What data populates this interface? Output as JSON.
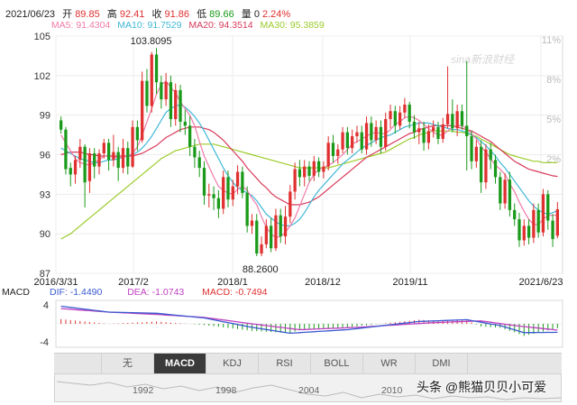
{
  "header": {
    "date": "2021/06/23",
    "open_label": "开",
    "open": "89.85",
    "high_label": "高",
    "high": "92.41",
    "close_label": "收",
    "close": "91.86",
    "low_label": "低",
    "low": "89.66",
    "vol_label": "量",
    "vol": "0",
    "change": "2.24%"
  },
  "ma": {
    "ma5": "MA5: 91.4304",
    "ma10": "MA10: 91.7529",
    "ma20": "MA20: 94.3514",
    "ma30": "MA30: 95.3859"
  },
  "colors": {
    "up": "#e03030",
    "down": "#1a9a1a",
    "ma5": "#f07aa8",
    "ma10": "#3fb8d8",
    "ma20": "#d83a5a",
    "ma30": "#9ccc2a",
    "dif": "#3a5ad0",
    "dea": "#c040c0"
  },
  "watermark_logo": "sina新浪财经",
  "chart_data": {
    "type": "candlestick",
    "ylim": [
      87,
      105
    ],
    "y_ticks": [
      "105",
      "102",
      "99",
      "96",
      "93",
      "90",
      "87"
    ],
    "right_ticks": [
      "11%",
      "8%",
      "5%",
      "2%"
    ],
    "x_ticks": [
      "2016/3/31",
      "2017/2",
      "2018/1",
      "2018/12",
      "2019/11",
      "2021/6/23"
    ],
    "annotations": [
      "103.8095",
      "88.2600"
    ],
    "candles": [
      [
        98.6,
        97.9,
        98.9,
        97.6
      ],
      [
        97.9,
        94.9,
        98.1,
        94.5
      ],
      [
        95.0,
        94.5,
        95.4,
        93.6
      ],
      [
        94.5,
        95.6,
        95.9,
        93.8
      ],
      [
        95.6,
        96.6,
        97.2,
        95.0
      ],
      [
        96.6,
        93.9,
        96.8,
        92.0
      ],
      [
        94.0,
        96.1,
        96.5,
        93.1
      ],
      [
        96.1,
        95.1,
        96.5,
        94.2
      ],
      [
        95.1,
        96.1,
        96.4,
        94.5
      ],
      [
        96.1,
        96.9,
        97.2,
        95.7
      ],
      [
        96.9,
        95.6,
        97.2,
        94.8
      ],
      [
        95.6,
        96.2,
        97.5,
        95.1
      ],
      [
        96.2,
        95.0,
        96.6,
        94.0
      ],
      [
        95.0,
        96.5,
        97.2,
        94.6
      ],
      [
        96.5,
        95.1,
        97.0,
        94.5
      ],
      [
        95.1,
        98.1,
        98.6,
        95.0
      ],
      [
        98.1,
        97.1,
        98.6,
        96.3
      ],
      [
        97.1,
        101.6,
        102.3,
        96.9
      ],
      [
        101.6,
        99.7,
        102.5,
        99.2
      ],
      [
        99.7,
        103.6,
        103.8,
        99.2
      ],
      [
        103.6,
        101.5,
        104.1,
        100.6
      ],
      [
        101.5,
        100.2,
        102.0,
        99.5
      ],
      [
        100.2,
        101.5,
        102.2,
        99.7
      ],
      [
        101.5,
        98.7,
        102.0,
        98.1
      ],
      [
        98.7,
        100.9,
        101.4,
        98.2
      ],
      [
        100.9,
        98.5,
        101.3,
        97.7
      ],
      [
        98.5,
        98.2,
        99.4,
        97.5
      ],
      [
        98.2,
        96.6,
        98.9,
        95.9
      ],
      [
        96.6,
        95.8,
        97.2,
        95.0
      ],
      [
        95.8,
        95.0,
        96.3,
        94.3
      ],
      [
        95.0,
        92.9,
        95.5,
        92.2
      ],
      [
        92.9,
        93.0,
        93.8,
        92.0
      ],
      [
        93.0,
        92.7,
        93.6,
        91.8
      ],
      [
        92.7,
        91.9,
        93.3,
        91.2
      ],
      [
        91.9,
        94.3,
        94.8,
        91.5
      ],
      [
        94.3,
        92.6,
        94.8,
        92.0
      ],
      [
        92.6,
        93.6,
        94.1,
        92.1
      ],
      [
        93.6,
        94.7,
        95.2,
        93.0
      ],
      [
        94.7,
        93.1,
        95.1,
        92.7
      ],
      [
        93.1,
        90.6,
        93.6,
        90.1
      ],
      [
        90.6,
        91.0,
        91.5,
        90.0
      ],
      [
        91.0,
        88.5,
        91.5,
        88.3
      ],
      [
        88.5,
        89.2,
        89.8,
        88.3
      ],
      [
        89.2,
        90.6,
        91.1,
        88.9
      ],
      [
        90.6,
        88.9,
        91.2,
        88.6
      ],
      [
        88.9,
        91.4,
        91.9,
        88.7
      ],
      [
        91.4,
        89.8,
        91.9,
        89.3
      ],
      [
        89.8,
        91.3,
        92.1,
        89.2
      ],
      [
        91.3,
        93.2,
        93.7,
        90.8
      ],
      [
        93.2,
        94.9,
        95.4,
        92.6
      ],
      [
        94.9,
        94.3,
        95.6,
        93.6
      ],
      [
        94.3,
        95.1,
        95.6,
        93.6
      ],
      [
        95.1,
        94.4,
        95.5,
        94.0
      ],
      [
        94.4,
        95.5,
        95.9,
        94.0
      ],
      [
        95.5,
        94.7,
        95.8,
        94.3
      ],
      [
        94.7,
        95.1,
        95.5,
        94.2
      ],
      [
        95.1,
        96.9,
        97.4,
        94.8
      ],
      [
        96.9,
        95.9,
        97.5,
        95.4
      ],
      [
        95.9,
        96.4,
        96.8,
        95.3
      ],
      [
        96.4,
        97.7,
        98.1,
        96.1
      ],
      [
        97.7,
        96.5,
        98.1,
        96.0
      ],
      [
        96.5,
        97.4,
        97.9,
        96.1
      ],
      [
        97.4,
        97.7,
        98.2,
        96.9
      ],
      [
        97.7,
        96.4,
        98.2,
        96.1
      ],
      [
        96.4,
        98.4,
        98.9,
        96.0
      ],
      [
        98.4,
        97.1,
        98.9,
        96.6
      ],
      [
        97.1,
        98.1,
        98.6,
        96.8
      ],
      [
        98.1,
        96.6,
        98.6,
        96.1
      ],
      [
        96.6,
        98.7,
        99.2,
        96.3
      ],
      [
        98.7,
        99.3,
        99.8,
        98.0
      ],
      [
        99.3,
        98.2,
        99.7,
        97.6
      ],
      [
        98.2,
        99.2,
        99.7,
        97.9
      ],
      [
        99.2,
        99.8,
        100.3,
        98.8
      ],
      [
        99.8,
        98.5,
        100.0,
        98.0
      ],
      [
        98.5,
        97.7,
        99.0,
        97.2
      ],
      [
        97.7,
        98.0,
        98.5,
        96.8
      ],
      [
        98.0,
        96.9,
        98.5,
        96.3
      ],
      [
        96.9,
        97.8,
        98.3,
        96.4
      ],
      [
        97.8,
        98.1,
        98.6,
        97.3
      ],
      [
        98.1,
        97.2,
        98.5,
        96.8
      ],
      [
        97.2,
        98.3,
        98.8,
        96.9
      ],
      [
        98.3,
        99.1,
        102.7,
        98.0
      ],
      [
        99.1,
        98.0,
        100.2,
        97.7
      ],
      [
        98.0,
        99.3,
        99.8,
        97.4
      ],
      [
        99.3,
        98.2,
        99.8,
        97.9
      ],
      [
        98.2,
        97.4,
        103.1,
        94.8
      ],
      [
        97.4,
        95.5,
        97.8,
        94.9
      ],
      [
        95.5,
        96.6,
        97.1,
        95.0
      ],
      [
        96.6,
        93.9,
        97.1,
        93.1
      ],
      [
        93.9,
        96.4,
        96.8,
        93.4
      ],
      [
        96.4,
        95.6,
        96.9,
        94.9
      ],
      [
        95.6,
        94.3,
        96.0,
        93.8
      ],
      [
        94.3,
        92.3,
        94.7,
        91.8
      ],
      [
        92.3,
        94.1,
        94.6,
        91.9
      ],
      [
        94.1,
        91.8,
        94.7,
        91.3
      ],
      [
        91.8,
        91.1,
        92.3,
        90.6
      ],
      [
        91.1,
        89.5,
        91.6,
        89.0
      ],
      [
        89.5,
        90.6,
        91.1,
        89.1
      ],
      [
        90.6,
        89.7,
        91.1,
        89.2
      ],
      [
        89.7,
        91.8,
        92.3,
        89.3
      ],
      [
        91.8,
        90.1,
        92.3,
        89.7
      ],
      [
        90.1,
        93.0,
        93.4,
        89.8
      ],
      [
        93.0,
        91.0,
        93.3,
        90.3
      ],
      [
        91.0,
        89.6,
        91.5,
        89.0
      ],
      [
        89.85,
        91.86,
        92.41,
        89.66
      ]
    ],
    "ma5": [
      97.5,
      96.9,
      96.3,
      95.7,
      95.4,
      95.3,
      95.2,
      95.4,
      95.6,
      95.9,
      95.9,
      95.8,
      95.8,
      95.8,
      95.9,
      96.1,
      96.6,
      97.5,
      98.5,
      99.5,
      100.6,
      101.3,
      101.6,
      101.1,
      100.7,
      100.0,
      99.5,
      99.0,
      98.2,
      97.0,
      95.9,
      95.1,
      94.3,
      93.6,
      93.3,
      93.1,
      93.0,
      93.4,
      93.6,
      93.3,
      92.7,
      92.2,
      91.3,
      90.5,
      90.0,
      89.7,
      89.8,
      90.1,
      90.6,
      91.2,
      92.1,
      93.0,
      93.9,
      94.5,
      94.9,
      95.0,
      95.2,
      95.4,
      95.7,
      96.0,
      96.4,
      96.8,
      97.0,
      97.2,
      97.4,
      97.6,
      97.7,
      97.6,
      97.6,
      97.9,
      98.3,
      98.5,
      98.8,
      98.9,
      98.8,
      98.6,
      98.3,
      98.0,
      97.7,
      97.5,
      97.5,
      97.8,
      98.1,
      98.2,
      98.2,
      98.0,
      97.6,
      97.2,
      96.6,
      96.2,
      95.7,
      95.2,
      94.9,
      94.5,
      93.8,
      93.2,
      92.4,
      91.7,
      91.1,
      90.7,
      90.7,
      91.1,
      91.4,
      91.4,
      91.4
    ],
    "ma10": [
      96.5,
      96.3,
      96.1,
      95.9,
      95.7,
      95.6,
      95.5,
      95.4,
      95.4,
      95.5,
      95.6,
      95.6,
      95.7,
      95.8,
      95.9,
      96.0,
      96.2,
      96.5,
      96.9,
      97.4,
      98.0,
      98.6,
      99.2,
      99.5,
      99.7,
      99.8,
      99.6,
      99.3,
      98.9,
      98.4,
      97.8,
      97.1,
      96.4,
      95.7,
      95.0,
      94.4,
      93.9,
      93.5,
      93.3,
      93.1,
      92.9,
      92.5,
      92.0,
      91.5,
      91.2,
      90.9,
      90.7,
      90.6,
      90.6,
      90.8,
      91.1,
      91.6,
      92.2,
      92.8,
      93.3,
      93.7,
      94.1,
      94.5,
      94.9,
      95.3,
      95.6,
      95.9,
      96.2,
      96.5,
      96.7,
      96.9,
      97.1,
      97.3,
      97.4,
      97.5,
      97.7,
      97.9,
      98.1,
      98.2,
      98.3,
      98.4,
      98.4,
      98.4,
      98.3,
      98.2,
      98.1,
      98.0,
      97.9,
      97.9,
      97.8,
      97.7,
      97.5,
      97.3,
      97.0,
      96.7,
      96.3,
      95.9,
      95.4,
      95.0,
      94.5,
      94.0,
      93.5,
      93.0,
      92.5,
      92.1,
      91.8,
      91.6,
      91.5,
      91.6,
      91.75
    ],
    "ma20": [
      96.0,
      96.1,
      96.2,
      96.2,
      96.2,
      96.1,
      96.0,
      96.0,
      95.9,
      95.9,
      95.9,
      95.9,
      95.9,
      95.9,
      95.9,
      95.9,
      96.0,
      96.1,
      96.3,
      96.5,
      96.7,
      97.0,
      97.3,
      97.5,
      97.7,
      97.9,
      98.0,
      98.1,
      98.1,
      98.1,
      98.0,
      97.9,
      97.7,
      97.4,
      97.1,
      96.7,
      96.3,
      95.9,
      95.5,
      95.0,
      94.6,
      94.2,
      93.8,
      93.5,
      93.1,
      92.8,
      92.6,
      92.4,
      92.2,
      92.2,
      92.2,
      92.3,
      92.4,
      92.6,
      92.8,
      93.1,
      93.4,
      93.7,
      94.0,
      94.3,
      94.6,
      94.9,
      95.2,
      95.5,
      95.8,
      96.0,
      96.2,
      96.4,
      96.6,
      96.8,
      97.0,
      97.2,
      97.4,
      97.6,
      97.7,
      97.9,
      98.0,
      98.1,
      98.2,
      98.2,
      98.2,
      98.2,
      98.2,
      98.1,
      98.0,
      97.9,
      97.8,
      97.6,
      97.4,
      97.2,
      97.0,
      96.7,
      96.4,
      96.1,
      95.8,
      95.5,
      95.3,
      95.1,
      94.9,
      94.8,
      94.7,
      94.6,
      94.5,
      94.4,
      94.35
    ],
    "ma30": [
      89.6,
      89.8,
      90.0,
      90.3,
      90.6,
      90.9,
      91.2,
      91.5,
      91.8,
      92.1,
      92.4,
      92.7,
      93.0,
      93.3,
      93.6,
      93.9,
      94.2,
      94.5,
      94.8,
      95.1,
      95.4,
      95.7,
      95.9,
      96.1,
      96.3,
      96.4,
      96.5,
      96.6,
      96.7,
      96.8,
      96.8,
      96.8,
      96.8,
      96.7,
      96.6,
      96.5,
      96.4,
      96.3,
      96.2,
      96.1,
      96.0,
      95.9,
      95.8,
      95.7,
      95.6,
      95.5,
      95.4,
      95.3,
      95.2,
      95.1,
      95.0,
      95.0,
      95.0,
      95.0,
      95.0,
      95.0,
      95.0,
      95.1,
      95.2,
      95.3,
      95.4,
      95.5,
      95.6,
      95.7,
      95.8,
      95.9,
      96.0,
      96.1,
      96.2,
      96.4,
      96.6,
      96.8,
      97.0,
      97.2,
      97.3,
      97.5,
      97.6,
      97.7,
      97.8,
      97.8,
      97.8,
      97.8,
      97.8,
      97.7,
      97.7,
      97.6,
      97.5,
      97.4,
      97.2,
      97.0,
      96.8,
      96.6,
      96.4,
      96.2,
      96.0,
      95.9,
      95.8,
      95.7,
      95.6,
      95.5,
      95.5,
      95.4,
      95.4,
      95.4,
      95.39
    ],
    "macd": {
      "ylim": [
        -4,
        4
      ],
      "y_ticks": [
        "4",
        "-4"
      ],
      "title": "MACD",
      "dif_label": "DIF: -1.4490",
      "dea_label": "DEA: -1.0743",
      "macd_label": "MACD: -0.7494",
      "dif_anchors": [
        [
          0,
          3.0
        ],
        [
          10,
          2.0
        ],
        [
          20,
          1.8
        ],
        [
          30,
          1.0
        ],
        [
          40,
          -0.6
        ],
        [
          48,
          -1.6
        ],
        [
          60,
          -1.0
        ],
        [
          75,
          0.4
        ],
        [
          85,
          0.7
        ],
        [
          92,
          -0.3
        ],
        [
          97,
          -1.5
        ],
        [
          104,
          -1.45
        ]
      ],
      "dea_anchors": [
        [
          0,
          2.6
        ],
        [
          10,
          2.0
        ],
        [
          20,
          1.6
        ],
        [
          30,
          1.1
        ],
        [
          40,
          0.0
        ],
        [
          50,
          -1.0
        ],
        [
          62,
          -0.6
        ],
        [
          78,
          0.2
        ],
        [
          88,
          0.5
        ],
        [
          95,
          -0.3
        ],
        [
          104,
          -1.07
        ]
      ]
    }
  },
  "tabs": [
    {
      "label": "无",
      "active": false
    },
    {
      "label": "MACD",
      "active": true
    },
    {
      "label": "KDJ",
      "active": false
    },
    {
      "label": "RSI",
      "active": false
    },
    {
      "label": "BOLL",
      "active": false
    },
    {
      "label": "WR",
      "active": false
    },
    {
      "label": "DMI",
      "active": false
    }
  ],
  "nav_buttons": {
    "up": "▲",
    "down": "▼"
  },
  "navigator_years": [
    "1992",
    "1998",
    "2004",
    "2010"
  ],
  "watermark_text": "头条 @熊猫贝贝小可爱"
}
